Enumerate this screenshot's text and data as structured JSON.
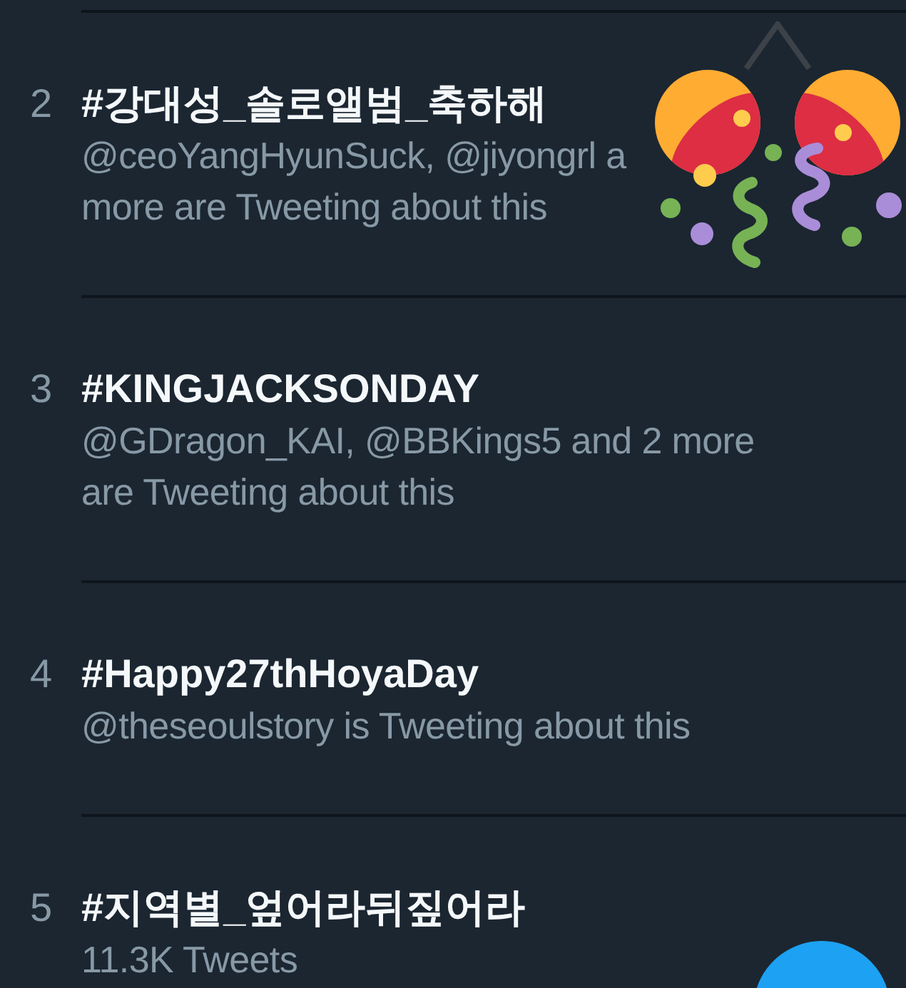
{
  "trends": [
    {
      "rank": "2",
      "hashtag": "#강대성_솔로앨범_축하해",
      "context": "@ceoYangHyunSuck, @jiyongrl a more are Tweeting about this"
    },
    {
      "rank": "3",
      "hashtag": "#KINGJACKSONDAY",
      "context": "@GDragon_KAI, @BBKings5 and 2 more are Tweeting about this"
    },
    {
      "rank": "4",
      "hashtag": "#Happy27thHoyaDay",
      "context": "@theseoulstory is Tweeting about this"
    },
    {
      "rank": "5",
      "hashtag": "#지역별_엎어라뒤짚어라",
      "context": "11.3K Tweets"
    }
  ]
}
